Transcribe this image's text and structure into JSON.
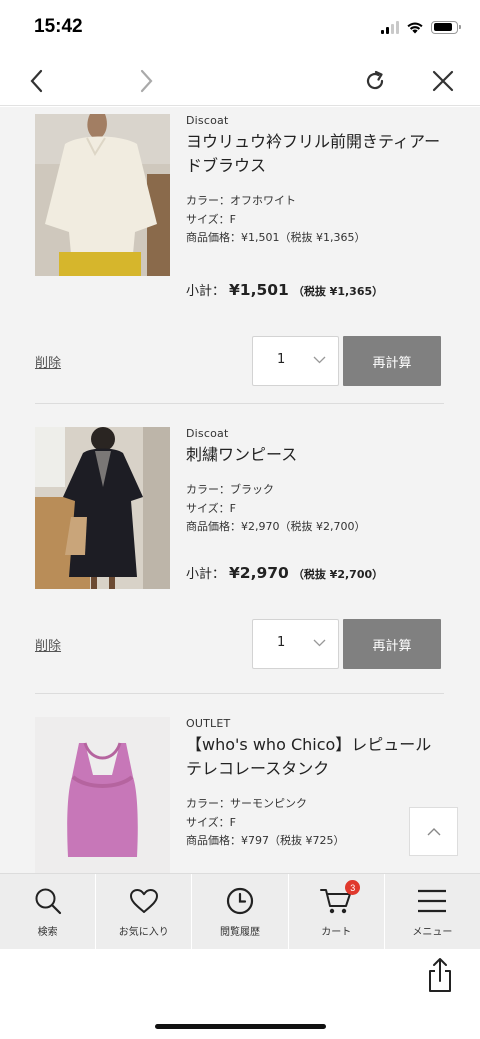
{
  "status_bar": {
    "time": "15:42"
  },
  "items": [
    {
      "brand": "Discoat",
      "title": "ヨウリュウ衿フリル前開きティアードブラウス",
      "color": "カラー：オフホワイト",
      "size": "サイズ：F",
      "price": "商品価格：¥1,501（税抜 ¥1,365）",
      "subtotal_label": "小計：",
      "subtotal_amount": "¥1,501",
      "subtotal_taxfree": "（税抜 ¥1,365）",
      "delete_label": "削除",
      "quantity": "1",
      "recalc_label": "再計算"
    },
    {
      "brand": "Discoat",
      "title": "刺繍ワンピース",
      "color": "カラー：ブラック",
      "size": "サイズ：F",
      "price": "商品価格：¥2,970（税抜 ¥2,700）",
      "subtotal_label": "小計：",
      "subtotal_amount": "¥2,970",
      "subtotal_taxfree": "（税抜 ¥2,700）",
      "delete_label": "削除",
      "quantity": "1",
      "recalc_label": "再計算"
    },
    {
      "brand": "OUTLET",
      "title": "【who's who Chico】レピュールテレコレースタンク",
      "color": "カラー：サーモンピンク",
      "size": "サイズ：F",
      "price": "商品価格：¥797（税抜 ¥725）"
    }
  ],
  "tabbar": {
    "tabs": [
      {
        "label": "検索",
        "icon": "search-icon"
      },
      {
        "label": "お気に入り",
        "icon": "heart-icon"
      },
      {
        "label": "閲覧履歴",
        "icon": "clock-icon"
      },
      {
        "label": "カート",
        "icon": "cart-icon",
        "badge": "3"
      },
      {
        "label": "メニュー",
        "icon": "hamburger-menu-icon"
      }
    ]
  },
  "colors": {
    "accent_badge": "#e0392d",
    "button_gray": "#808080",
    "content_bg": "#f3f3f3"
  }
}
